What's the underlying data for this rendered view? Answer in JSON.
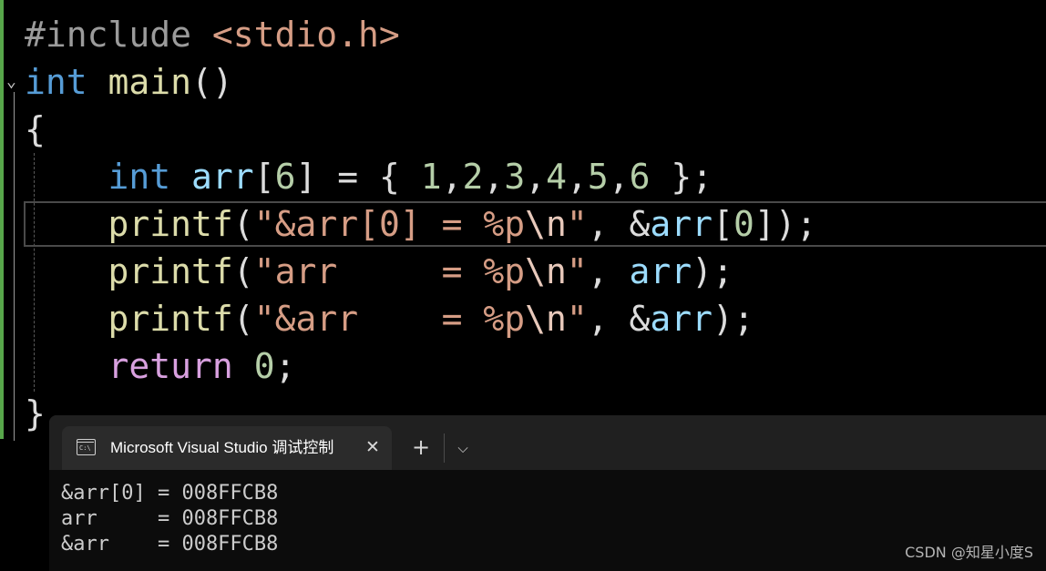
{
  "editor": {
    "fold_icon": "chevron-down-icon",
    "lines": [
      [
        {
          "t": "#include ",
          "c": "pre"
        },
        {
          "t": "<stdio.h>",
          "c": "str"
        }
      ],
      [
        {
          "t": "int",
          "c": "kw"
        },
        {
          "t": " ",
          "c": "pun"
        },
        {
          "t": "main",
          "c": "fn"
        },
        {
          "t": "()",
          "c": "pun"
        }
      ],
      [
        {
          "t": "{",
          "c": "pun"
        }
      ],
      [
        {
          "t": "    ",
          "c": "pun"
        },
        {
          "t": "int",
          "c": "kw"
        },
        {
          "t": " ",
          "c": "pun"
        },
        {
          "t": "arr",
          "c": "var"
        },
        {
          "t": "[",
          "c": "pun"
        },
        {
          "t": "6",
          "c": "num"
        },
        {
          "t": "] = { ",
          "c": "pun"
        },
        {
          "t": "1",
          "c": "num"
        },
        {
          "t": ",",
          "c": "pun"
        },
        {
          "t": "2",
          "c": "num"
        },
        {
          "t": ",",
          "c": "pun"
        },
        {
          "t": "3",
          "c": "num"
        },
        {
          "t": ",",
          "c": "pun"
        },
        {
          "t": "4",
          "c": "num"
        },
        {
          "t": ",",
          "c": "pun"
        },
        {
          "t": "5",
          "c": "num"
        },
        {
          "t": ",",
          "c": "pun"
        },
        {
          "t": "6",
          "c": "num"
        },
        {
          "t": " };",
          "c": "pun"
        }
      ],
      [
        {
          "t": "    ",
          "c": "pun"
        },
        {
          "t": "printf",
          "c": "fn"
        },
        {
          "t": "(",
          "c": "pun"
        },
        {
          "t": "\"&arr[0] = %p",
          "c": "str"
        },
        {
          "t": "\\n",
          "c": "esc"
        },
        {
          "t": "\"",
          "c": "str"
        },
        {
          "t": ", &",
          "c": "pun"
        },
        {
          "t": "arr",
          "c": "var"
        },
        {
          "t": "[",
          "c": "pun"
        },
        {
          "t": "0",
          "c": "num"
        },
        {
          "t": "]);",
          "c": "pun"
        }
      ],
      [
        {
          "t": "    ",
          "c": "pun"
        },
        {
          "t": "printf",
          "c": "fn"
        },
        {
          "t": "(",
          "c": "pun"
        },
        {
          "t": "\"arr     = %p",
          "c": "str"
        },
        {
          "t": "\\n",
          "c": "esc"
        },
        {
          "t": "\"",
          "c": "str"
        },
        {
          "t": ", ",
          "c": "pun"
        },
        {
          "t": "arr",
          "c": "var"
        },
        {
          "t": ");",
          "c": "pun"
        }
      ],
      [
        {
          "t": "    ",
          "c": "pun"
        },
        {
          "t": "printf",
          "c": "fn"
        },
        {
          "t": "(",
          "c": "pun"
        },
        {
          "t": "\"&arr    = %p",
          "c": "str"
        },
        {
          "t": "\\n",
          "c": "esc"
        },
        {
          "t": "\"",
          "c": "str"
        },
        {
          "t": ", &",
          "c": "pun"
        },
        {
          "t": "arr",
          "c": "var"
        },
        {
          "t": ");",
          "c": "pun"
        }
      ],
      [
        {
          "t": "    ",
          "c": "pun"
        },
        {
          "t": "return",
          "c": "ctl"
        },
        {
          "t": " ",
          "c": "pun"
        },
        {
          "t": "0",
          "c": "num"
        },
        {
          "t": ";",
          "c": "pun"
        }
      ],
      [
        {
          "t": "}",
          "c": "pun"
        }
      ]
    ],
    "colors": {
      "pre": "#9b9b9b",
      "str": "#d69d85",
      "kw": "#569cd6",
      "fn": "#dcdcaa",
      "var": "#9cdcfe",
      "num": "#b5cea8",
      "ctl": "#d8a0df",
      "esc": "#e8c9bb",
      "pun": "#dcdcdc",
      "change_bar": "#57a64a"
    }
  },
  "console": {
    "tab_icon": "console-app-icon",
    "tab_icon_text": "C:\\",
    "tab_title": "Microsoft Visual Studio 调试控制台",
    "close_symbol": "✕",
    "new_tab_symbol": "+",
    "dropdown_symbol": "⌵",
    "output": [
      "&arr[0] = 008FFCB8",
      "arr     = 008FFCB8",
      "&arr    = 008FFCB8"
    ]
  },
  "watermark": "CSDN @知星小度S"
}
